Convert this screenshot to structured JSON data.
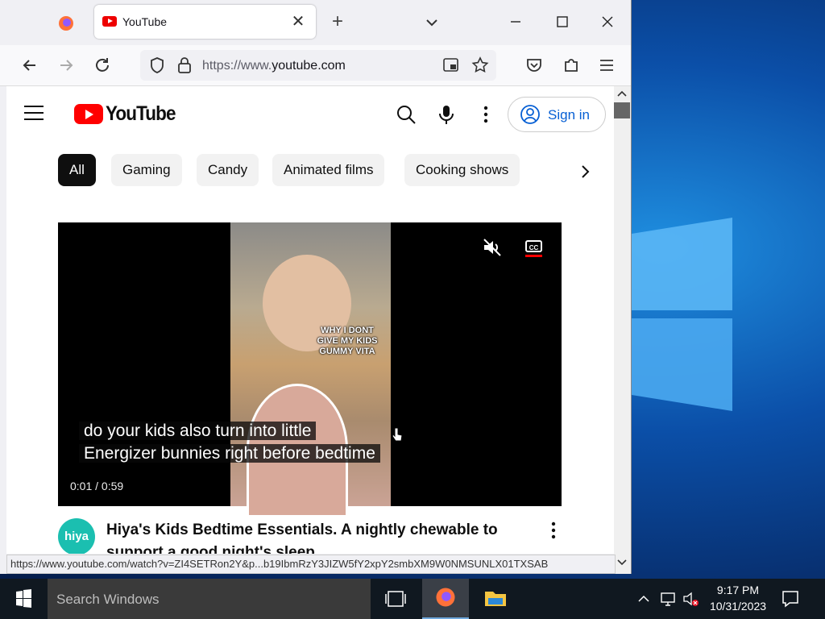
{
  "browser": {
    "tab": {
      "title": "YouTube"
    },
    "url": {
      "prefix": "https://www.",
      "domain": "youtube.com"
    },
    "status_url": "https://www.youtube.com/watch?v=ZI4SETRon2Y&p...b19IbmRzY3JIZW5fY2xpY2smbXM9W0NMSUNLX01TXSAB"
  },
  "youtube": {
    "logo_text": "YouTube",
    "sign_in": "Sign in",
    "chips": [
      "All",
      "Gaming",
      "Candy",
      "Animated films",
      "Cooking shows"
    ],
    "video": {
      "overlay_text": "WHY I DONT GIVE MY KIDS GUMMY VITA",
      "cc_label": "CC",
      "caption_line1": "do your kids also turn into little",
      "caption_line2": "Energizer bunnies right before bedtime",
      "time": "0:01 / 0:59"
    },
    "result": {
      "channel_avatar_text": "hiya",
      "title": "Hiya's Kids Bedtime Essentials. A nightly chewable to support a good night's sleep"
    }
  },
  "taskbar": {
    "search_placeholder": "Search Windows",
    "time": "9:17 PM",
    "date": "10/31/2023"
  },
  "colors": {
    "youtube_red": "#ff0000",
    "link_blue": "#065fd4",
    "chip_active": "#0f0f0f"
  }
}
